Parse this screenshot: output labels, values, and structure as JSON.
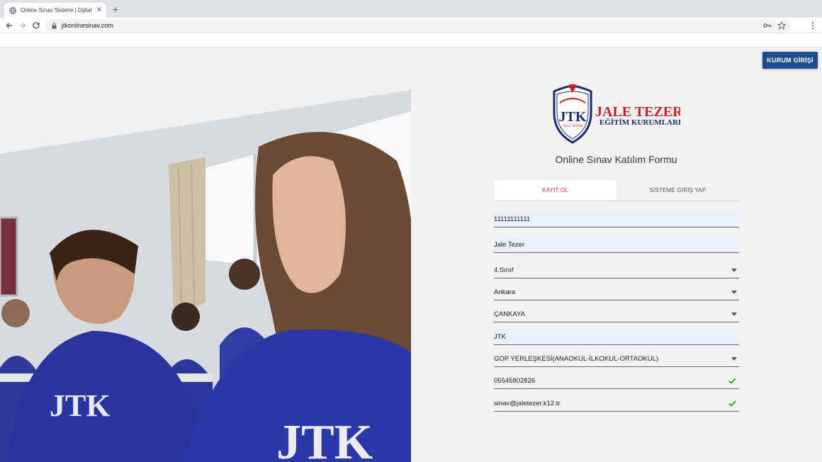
{
  "browser": {
    "tab_title": "Online Sınav Sistemi | Dijital Ö...",
    "url": "jtkonlinesinav.com"
  },
  "header": {
    "kurum_button": "KURUM GİRİŞİ"
  },
  "logo": {
    "name_line1": "JALE TEZER",
    "name_line2": "EĞİTİM KURUMLARI",
    "shield_text": "JTK",
    "shield_subtext": "JALE TEZER"
  },
  "form": {
    "title": "Online Sınav Katılım Formu",
    "tabs": [
      {
        "label": "KAYIT OL",
        "active": true
      },
      {
        "label": "SİSTEME GİRİŞ YAP",
        "active": false
      }
    ],
    "fields": {
      "tc": "11111111111",
      "name": "Jale Tezer",
      "grade": "4.Sınıf",
      "city": "Ankara",
      "district": "ÇANKAYA",
      "school": "JTK",
      "campus": "GOP YERLEŞKESİ(ANAOKUL-İLKOKUL-ORTAOKUL)",
      "phone": "05545802826",
      "email": "sinav@jaletezer.k12.tr"
    }
  },
  "colors": {
    "brand_blue": "#1d4d8f",
    "brand_red": "#c0202e",
    "active_tab": "#e0246a",
    "check_green": "#43a047"
  }
}
